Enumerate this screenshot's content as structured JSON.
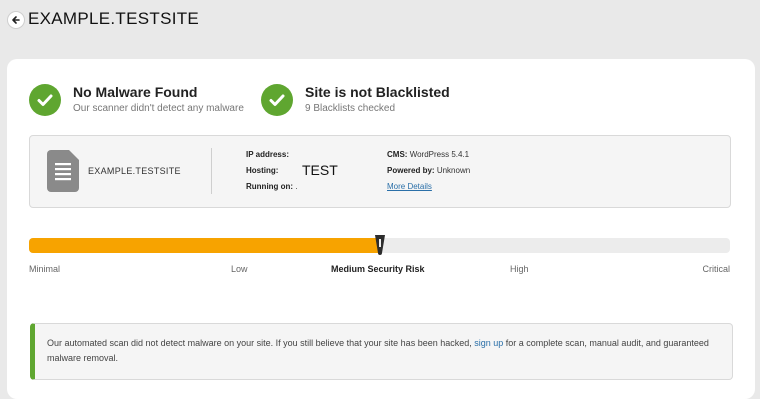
{
  "header": {
    "site": "EXAMPLE.TESTSITE"
  },
  "status": [
    {
      "title": "No Malware Found",
      "subtitle": "Our scanner didn't detect any malware"
    },
    {
      "title": "Site is not Blacklisted",
      "subtitle": "9 Blacklists checked"
    }
  ],
  "info": {
    "site": "EXAMPLE.TESTSITE",
    "ip_label": "IP address:",
    "ip_value": "",
    "hosting_label": "Hosting:",
    "hosting_value": "TEST",
    "running_label": "Running on:",
    "running_value": ".",
    "cms_label": "CMS:",
    "cms_value": "WordPress 5.4.1",
    "powered_label": "Powered by:",
    "powered_value": "Unknown",
    "more_details": "More Details"
  },
  "risk": {
    "level": 0.5,
    "labels": [
      "Minimal",
      "Low",
      "Medium Security Risk",
      "High",
      "Critical"
    ],
    "active_index": 2,
    "fill_color": "#f7a300"
  },
  "notice": {
    "before": "Our automated scan did not detect malware on your site. If you still believe that your site has been hacked, ",
    "link": "sign up",
    "after": " for a complete scan, manual audit, and guaranteed malware removal."
  },
  "colors": {
    "accent_green": "#5fa630",
    "link": "#2a6fa8"
  }
}
